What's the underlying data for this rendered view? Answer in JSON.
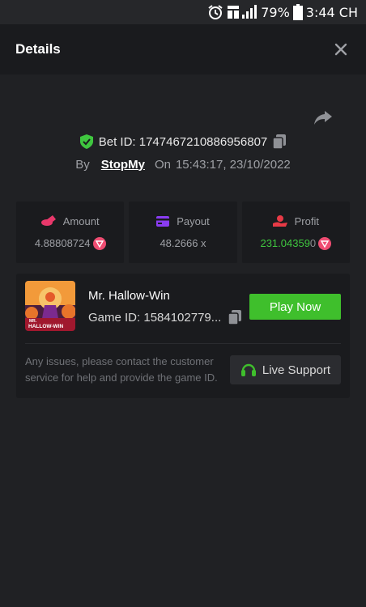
{
  "status_bar": {
    "battery": "79%",
    "time": "3:44 CH"
  },
  "header": {
    "title": "Details"
  },
  "bet": {
    "id_text": "Bet ID: 1747467210886956807",
    "by_label": "By",
    "user": "StopMy",
    "on_label": "On",
    "datetime": "15:43:17, 23/10/2022"
  },
  "stats": {
    "amount": {
      "label": "Amount",
      "value": "4.88808724"
    },
    "payout": {
      "label": "Payout",
      "value": "48.2666 x"
    },
    "profit": {
      "label": "Profit",
      "value": "231.04359",
      "value_tail": "0"
    }
  },
  "game": {
    "name": "Mr. Hallow-Win",
    "id_text": "Game ID: 1584102779...",
    "thumb_text_top": "MR.",
    "thumb_text_bottom": "HALLOW-WIN",
    "play_label": "Play Now"
  },
  "support": {
    "issues_text": "Any issues, please contact the customer service for help and provide the game ID.",
    "live_label": "Live Support"
  },
  "colors": {
    "background": "#202124",
    "panel": "#1a1b1e",
    "accent_green": "#3fbf2c",
    "profit_green": "#3fc63f",
    "amount_icon": "#e8386b",
    "payout_icon": "#8a3cf2",
    "profit_icon": "#e83a46"
  },
  "icons": [
    "alarm-icon",
    "signal-icon",
    "battery-icon",
    "close-icon",
    "share-icon",
    "shield-check-icon",
    "copy-icon",
    "coins-icon",
    "card-icon",
    "profit-hand-icon",
    "coin-icon",
    "headset-icon"
  ]
}
